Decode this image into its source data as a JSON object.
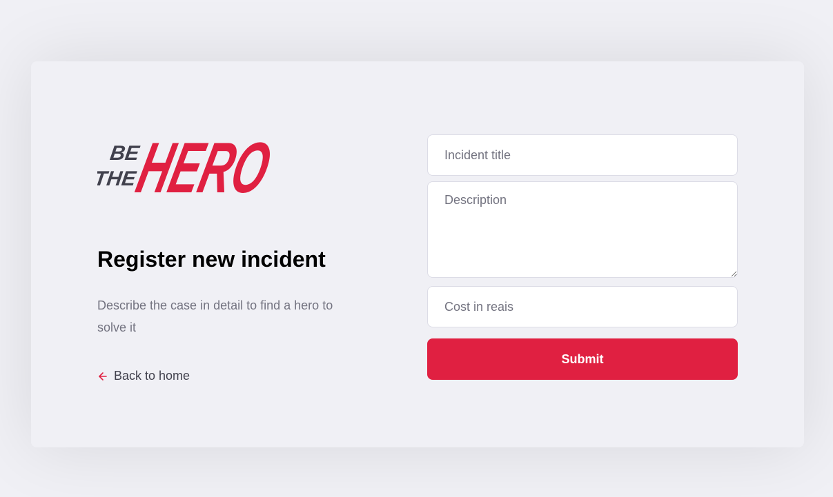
{
  "logo": {
    "line1": "BE",
    "line2": "THE",
    "brand": "HERO",
    "brand_color": "#E02041",
    "secondary_color": "#41414D"
  },
  "header": {
    "title": "Register new incident",
    "description": "Describe the case in detail to find a hero to solve it"
  },
  "back_link": {
    "label": "Back to home",
    "icon": "arrow-left-icon",
    "icon_color": "#E02041"
  },
  "form": {
    "title_placeholder": "Incident title",
    "title_value": "",
    "description_placeholder": "Description",
    "description_value": "",
    "cost_placeholder": "Cost in reais",
    "cost_value": "",
    "submit_label": "Submit"
  },
  "colors": {
    "background": "#F0F0F5",
    "accent": "#E02041",
    "text_muted": "#737380",
    "text_dark": "#41414D"
  }
}
